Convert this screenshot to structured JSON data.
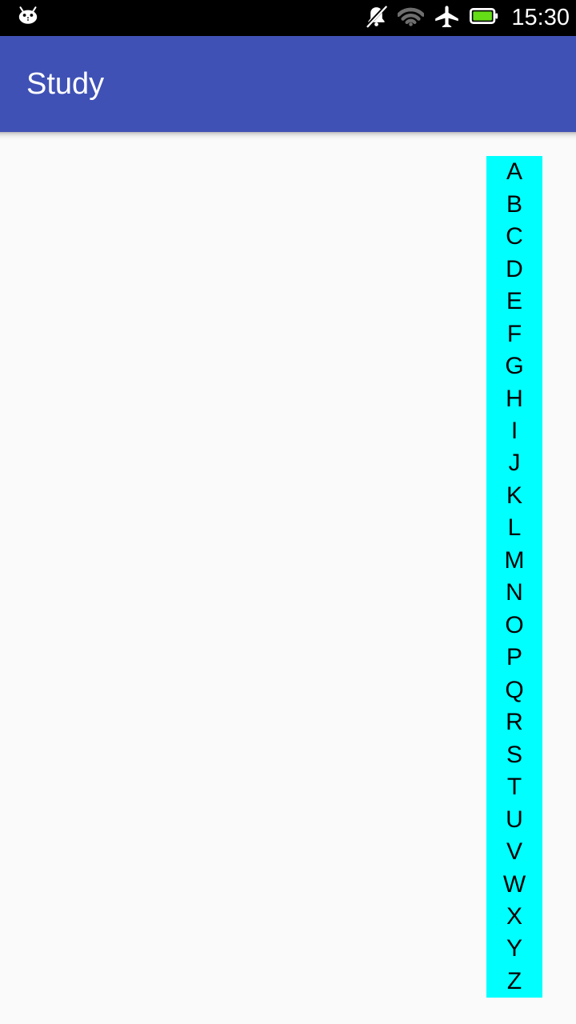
{
  "status_bar": {
    "background_color": "#000000",
    "notification_icon": "android-robot-icon",
    "icons": [
      {
        "name": "silent-mode-icon",
        "label": "Silent mode"
      },
      {
        "name": "wifi-icon",
        "label": "Wi-Fi"
      },
      {
        "name": "airplane-mode-icon",
        "label": "Airplane mode"
      },
      {
        "name": "battery-icon",
        "label": "Battery full"
      }
    ],
    "clock": "15:30",
    "wifi_color": "#757575",
    "battery_fill_color": "#64DD17",
    "icon_color": "#FFFFFF"
  },
  "app_bar": {
    "title": "Study",
    "background_color": "#3F51B5",
    "text_color": "#FFFFFF"
  },
  "content": {
    "background_color": "#FAFAFA"
  },
  "alphabet_index": {
    "background_color": "#00FFFF",
    "text_color": "#000000",
    "letters": [
      "A",
      "B",
      "C",
      "D",
      "E",
      "F",
      "G",
      "H",
      "I",
      "J",
      "K",
      "L",
      "M",
      "N",
      "O",
      "P",
      "Q",
      "R",
      "S",
      "T",
      "U",
      "V",
      "W",
      "X",
      "Y",
      "Z"
    ]
  }
}
